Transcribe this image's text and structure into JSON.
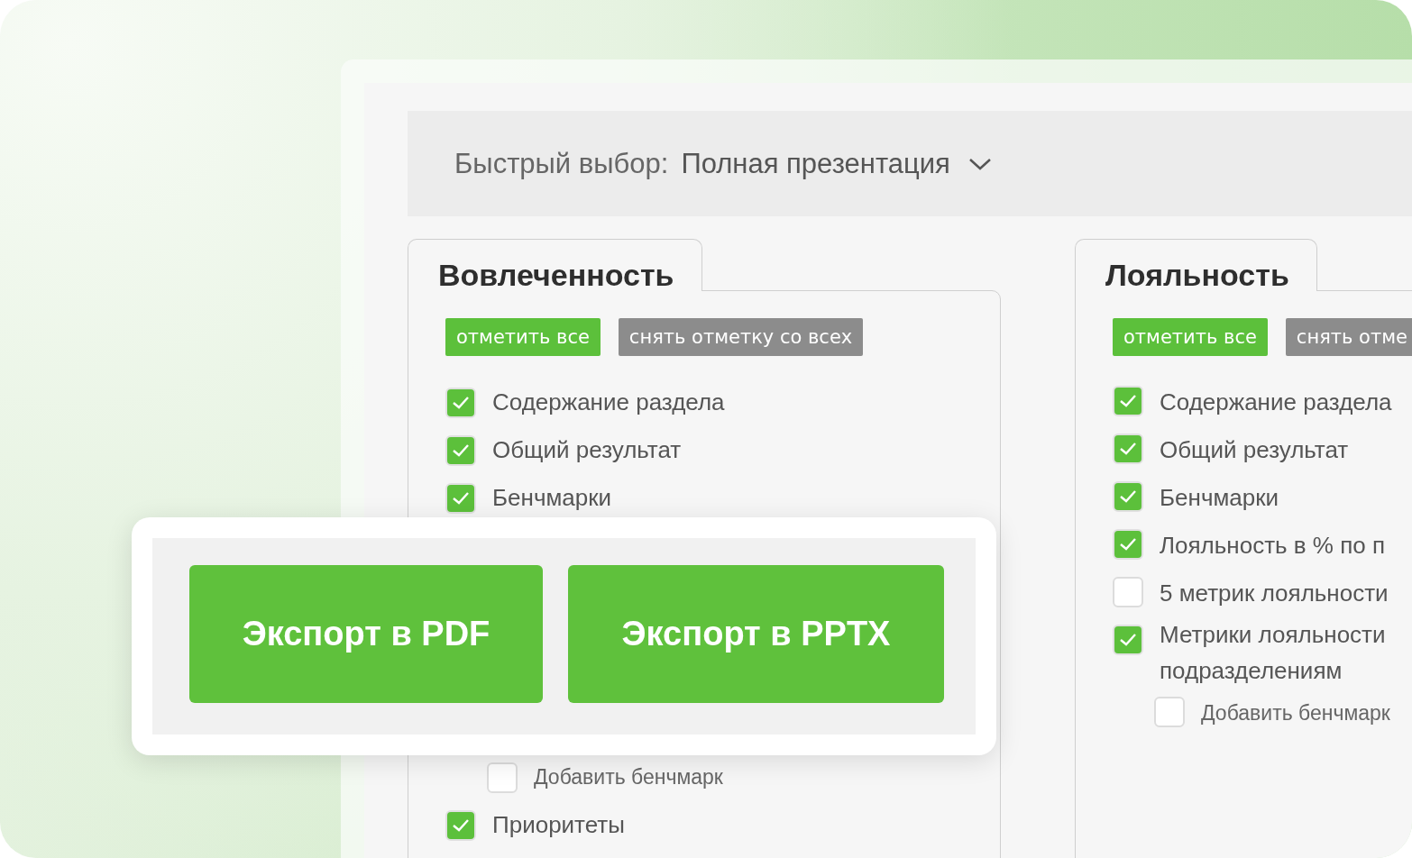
{
  "quick_select": {
    "label": "Быстрый выбор:",
    "value": "Полная презентация"
  },
  "sections": [
    {
      "title": "Вовлеченность",
      "check_all": "отметить все",
      "uncheck_all": "снять отметку со всех",
      "items": [
        {
          "label": "Содержание раздела",
          "checked": true,
          "kind": "item"
        },
        {
          "label": "Общий результат",
          "checked": true,
          "kind": "item"
        },
        {
          "label": "Бенчмарки",
          "checked": true,
          "kind": "item"
        },
        {
          "label": "Добавить бенчмарк",
          "checked": false,
          "kind": "sub"
        },
        {
          "label": "Приоритеты",
          "checked": true,
          "kind": "item"
        }
      ]
    },
    {
      "title": "Лояльность",
      "check_all": "отметить все",
      "uncheck_all": "снять отме",
      "items": [
        {
          "label": "Содержание раздела",
          "checked": true,
          "kind": "item"
        },
        {
          "label": "Общий результат",
          "checked": true,
          "kind": "item"
        },
        {
          "label": "Бенчмарки",
          "checked": true,
          "kind": "item"
        },
        {
          "label": "Лояльность в % по п",
          "checked": true,
          "kind": "item"
        },
        {
          "label": "5 метрик лояльности",
          "checked": false,
          "kind": "item"
        },
        {
          "label": "Метрики лояльности подразделениям",
          "checked": true,
          "kind": "item"
        },
        {
          "label": "Добавить бенчмарк",
          "checked": false,
          "kind": "sub"
        }
      ]
    }
  ],
  "export_buttons": [
    "Экспорт в PDF",
    "Экспорт в PPTX"
  ]
}
